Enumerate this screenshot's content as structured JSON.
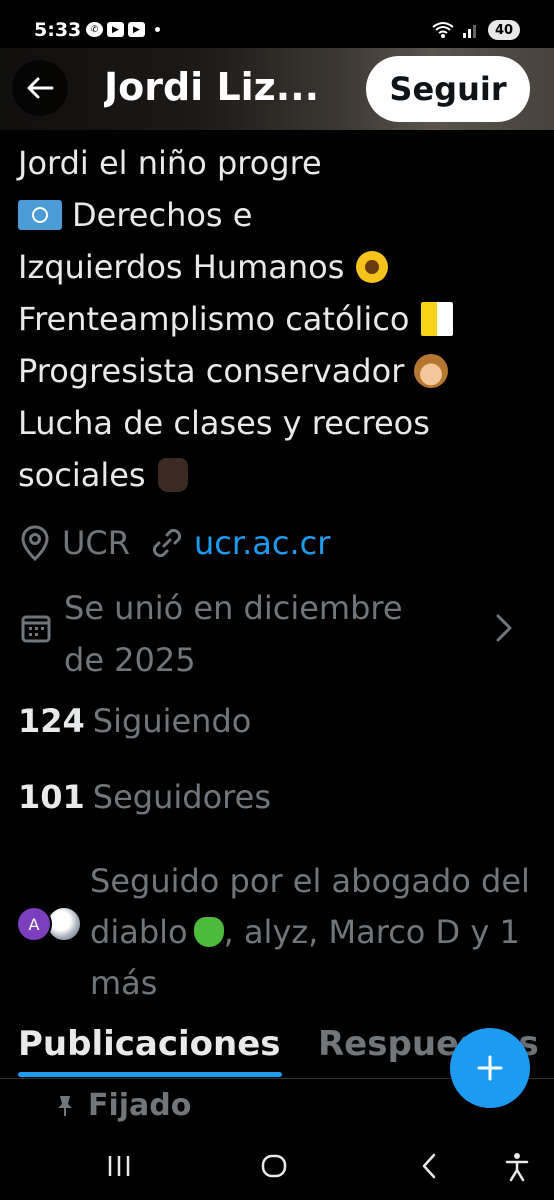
{
  "status_bar": {
    "time": "5:33",
    "battery": "40"
  },
  "header": {
    "title": "Jordi Liz...",
    "follow_label": "Seguir"
  },
  "bio": {
    "line1": "Jordi el niño progre",
    "line2": "Derechos e",
    "line3": "Izquierdos Humanos",
    "line4": "Frenteamplismo católico",
    "line5": "Progresista conservador",
    "line6": "Lucha de clases y recreos",
    "line7": "sociales"
  },
  "profile_info": {
    "location": "UCR",
    "website": "ucr.ac.cr",
    "joined_line1": "Se unió en diciembre",
    "joined_line2": "de 2025"
  },
  "stats": {
    "following_count": "124",
    "following_label": "Siguiendo",
    "followers_count": "101",
    "followers_label": "Seguidores"
  },
  "followed_by": {
    "text_part1": "Seguido por el abogado del diablo",
    "text_part2": ", alyz, Marco D y 1 más",
    "avatar_initial": "A"
  },
  "tabs": {
    "active": "Publicaciones",
    "second": "Respuestas"
  },
  "pinned": {
    "label": "Fijado"
  },
  "colors": {
    "accent": "#1d9bf0",
    "background": "#000000",
    "text_primary": "#e7e9ea",
    "text_secondary": "#71767b"
  },
  "icons": {
    "back": "arrow-left-icon",
    "location": "location-pin-icon",
    "link": "link-icon",
    "calendar": "calendar-icon",
    "chevron": "chevron-right-icon",
    "compose": "plus-icon",
    "pin": "pin-icon"
  }
}
